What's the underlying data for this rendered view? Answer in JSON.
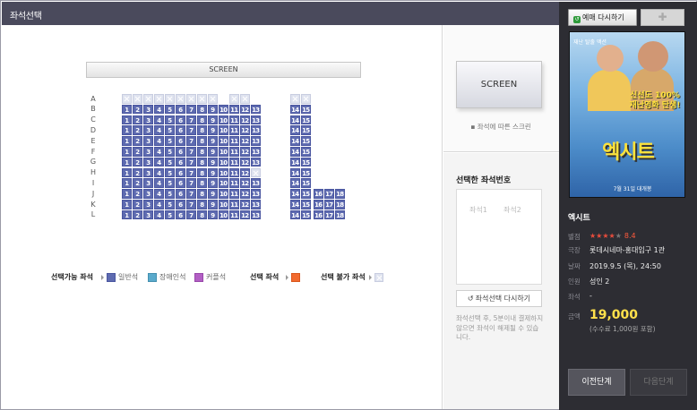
{
  "window": {
    "title": "좌석선택"
  },
  "screen": {
    "label": "SCREEN"
  },
  "rows": [
    {
      "label": "A",
      "seats": [
        "x",
        "x",
        "x",
        "x",
        "x",
        "x",
        "x",
        "x",
        "x",
        null,
        "x",
        "x",
        null,
        "x",
        "x",
        null,
        null,
        null
      ]
    },
    {
      "label": "B",
      "seats": [
        "1",
        "2",
        "3",
        "4",
        "5",
        "6",
        "7",
        "8",
        "9",
        "10",
        "11",
        "12",
        "13",
        "14",
        "15",
        null,
        null,
        null
      ]
    },
    {
      "label": "C",
      "seats": [
        "1",
        "2",
        "3",
        "4",
        "5",
        "6",
        "7",
        "8",
        "9",
        "10",
        "11",
        "12",
        "13",
        "14",
        "15",
        null,
        null,
        null
      ]
    },
    {
      "label": "D",
      "seats": [
        "1",
        "2",
        "3",
        "4",
        "5",
        "6",
        "7",
        "8",
        "9",
        "10",
        "11",
        "12",
        "13",
        "14",
        "15",
        null,
        null,
        null
      ]
    },
    {
      "label": "E",
      "seats": [
        "1",
        "2",
        "3",
        "4",
        "5",
        "6",
        "7",
        "8",
        "9",
        "10",
        "11",
        "12",
        "13",
        "14",
        "15",
        null,
        null,
        null
      ]
    },
    {
      "label": "F",
      "seats": [
        "1",
        "2",
        "3",
        "4",
        "5",
        "6",
        "7",
        "8",
        "9",
        "10",
        "11",
        "12",
        "13",
        "14",
        "15",
        null,
        null,
        null
      ]
    },
    {
      "label": "G",
      "seats": [
        "1",
        "2",
        "3",
        "4",
        "5",
        "6",
        "7",
        "8",
        "9",
        "10",
        "11",
        "12",
        "13",
        "14",
        "15",
        null,
        null,
        null
      ]
    },
    {
      "label": "H",
      "seats": [
        "1",
        "2",
        "3",
        "4",
        "5",
        "6",
        "7",
        "8",
        "9",
        "10",
        "11",
        "12",
        "x",
        "14",
        "15",
        null,
        null,
        null
      ]
    },
    {
      "label": "I",
      "seats": [
        "1",
        "2",
        "3",
        "4",
        "5",
        "6",
        "7",
        "8",
        "9",
        "10",
        "11",
        "12",
        "13",
        "14",
        "15",
        null,
        null,
        null
      ]
    },
    {
      "label": "J",
      "seats": [
        "1",
        "2",
        "3",
        "4",
        "5",
        "6",
        "7",
        "8",
        "9",
        "10",
        "11",
        "12",
        "13",
        "14",
        "15",
        "16",
        "17",
        "18"
      ]
    },
    {
      "label": "K",
      "seats": [
        "1",
        "2",
        "3",
        "4",
        "5",
        "6",
        "7",
        "8",
        "9",
        "10",
        "11",
        "12",
        "13",
        "14",
        "15",
        "16",
        "17",
        "18"
      ]
    },
    {
      "label": "L",
      "seats": [
        "1",
        "2",
        "3",
        "4",
        "5",
        "6",
        "7",
        "8",
        "9",
        "10",
        "11",
        "12",
        "13",
        "14",
        "15",
        "16",
        "17",
        "18"
      ]
    }
  ],
  "legend": {
    "available_title": "선택가능 좌석",
    "general": "일반석",
    "disabled": "장애인석",
    "couple": "커플석",
    "selected_title": "선택 좌석",
    "unavailable_title": "선택 불가 좌석",
    "colors": {
      "general": "#5e6bb0",
      "disabled": "#5aaacc",
      "couple": "#b25fc4",
      "selected": "#f26a2e",
      "unavailable": "#dfe3ef"
    }
  },
  "mid": {
    "screen_thumb": "SCREEN",
    "screen_note": "▪ 좌석에 따른 스크린",
    "selected_title": "선택한 좌석번호",
    "slot1": "좌석1",
    "slot2": "좌석2",
    "reset_label": "좌석선택 다시하기",
    "note": "좌석선택 후, 5분이내 결제하지 않으면 좌석이 해제될 수 있습니다."
  },
  "right": {
    "rebook_label": "예매 다시하기",
    "poster": {
      "sub": "재난 탈출 액션",
      "tagline": "신선도 100% 재난영화 탄생!",
      "title": "엑시트",
      "date": "7월 31일 대개봉"
    },
    "movie_title": "엑시트",
    "rating_key": "별점",
    "rating_stars": 4,
    "rating_max": 5,
    "rating_value": "8.4",
    "theater_key": "극장",
    "theater_value": "롯데시네마-홍대입구 1관",
    "date_key": "날짜",
    "date_value": "2019.9.5 (목), 24:50",
    "people_key": "인원",
    "people_value": "성인 2",
    "seat_key": "좌석",
    "seat_value": "-",
    "price_key": "금액",
    "price_value": "19,000",
    "fee_note": "(수수료 1,000원 포함)",
    "prev_label": "이전단계",
    "next_label": "다음단계"
  }
}
